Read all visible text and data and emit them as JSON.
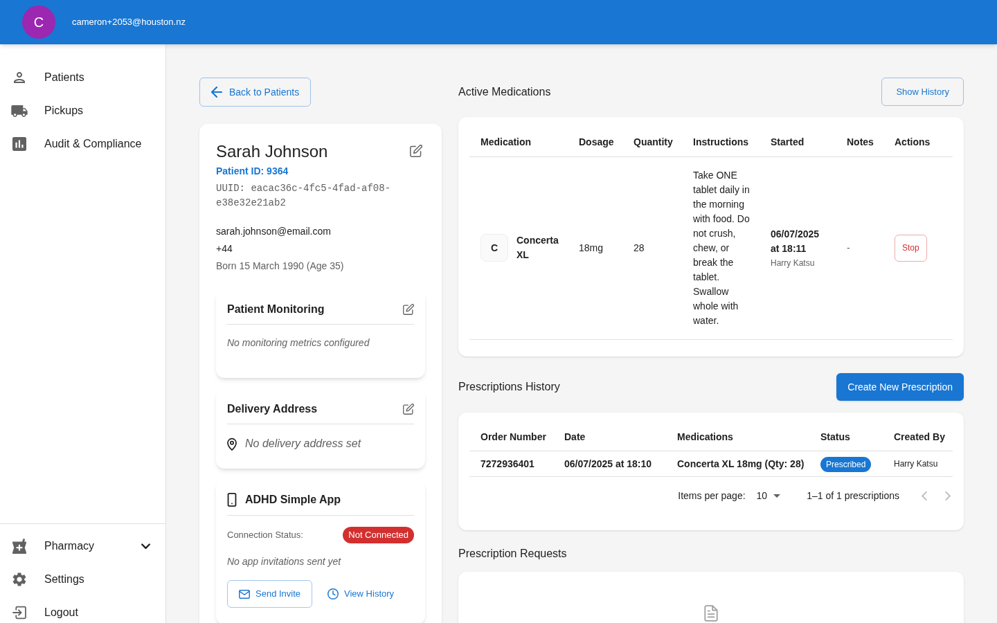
{
  "header": {
    "avatar_letter": "C",
    "email": "cameron+2053@houston.nz"
  },
  "sidebar": {
    "items": [
      {
        "label": "Patients"
      },
      {
        "label": "Pickups"
      },
      {
        "label": "Audit & Compliance"
      }
    ],
    "bottom_items": [
      {
        "label": "Pharmacy",
        "kind": "group",
        "expanded": false
      },
      {
        "label": "Settings",
        "kind": "link"
      },
      {
        "label": "Logout",
        "kind": "link"
      }
    ]
  },
  "back_button": "Back to Patients",
  "patient": {
    "name": "Sarah Johnson",
    "patient_id": "Patient ID: 9364",
    "uuid": "UUID: eacac36c-4fc5-4fad-af08-e38e32e21ab2",
    "email": "sarah.johnson@email.com",
    "phone": "+44",
    "born": "Born 15 March 1990 (Age 35)"
  },
  "monitoring": {
    "title": "Patient Monitoring",
    "empty_text": "No monitoring metrics configured"
  },
  "delivery_address": {
    "title": "Delivery Address",
    "empty_text": "No delivery address set"
  },
  "app": {
    "title": "ADHD Simple App",
    "connection_label": "Connection Status:",
    "connection_status": "Not Connected",
    "connected": false,
    "note": "No app invitations sent yet",
    "buttons": [
      {
        "label": "Send Invite",
        "kind": "outlined"
      },
      {
        "label": "View History",
        "kind": "text"
      }
    ]
  },
  "active_medications": {
    "title": "Active Medications",
    "button": "Show History",
    "columns": [
      "Medication",
      "Dosage",
      "Quantity",
      "Instructions",
      "Started",
      "Notes",
      "Actions"
    ],
    "rows": [
      {
        "avatar_letter": "C",
        "medication": "Concerta XL",
        "dosage": "18mg",
        "quantity": "28",
        "instructions": "Take ONE tablet daily in the morning with food. Do not crush, chew, or break the tablet. Swallow whole with water.",
        "started": "06/07/2025 at 18:11",
        "started_by": "Harry Katsu",
        "notes": "-",
        "action": "Stop"
      }
    ]
  },
  "prescriptions_history": {
    "title": "Prescriptions History",
    "button": "Create New Prescription",
    "columns": [
      "Order Number",
      "Date",
      "Medications",
      "Status",
      "Created By"
    ],
    "rows": [
      {
        "order_number": "7272936401",
        "date": "06/07/2025 at 18:10",
        "medications": "Concerta XL 18mg (Qty: 28)",
        "status": "Prescribed",
        "created_by": "Harry Katsu"
      }
    ],
    "pagination": {
      "items_per_page_label": "Items per page:",
      "items_per_page": "10",
      "range": "1–1 of 1 prescriptions",
      "prev_disabled": true,
      "next_disabled": true
    }
  },
  "prescription_requests": {
    "title": "Prescription Requests"
  }
}
